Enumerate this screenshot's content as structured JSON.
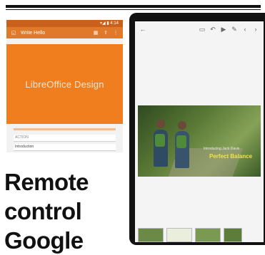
{
  "left_phone": {
    "status_text": "▾◢ ▮ 4:14",
    "appbar_title": "Write Hello",
    "banner_text": "LibreOffice Design",
    "field_label": "ACTION",
    "field_value": "Introduction",
    "icons": [
      "libreoffice-icon",
      "grid-icon",
      "share-icon",
      "more-icon"
    ]
  },
  "heading": {
    "line1": "Remote",
    "line2": "control",
    "line3": "Google"
  },
  "tablet": {
    "toolbar_icons": [
      "back-icon",
      "window-icon",
      "undo-icon",
      "play-icon",
      "pointer-icon",
      "prev-icon",
      "next-icon"
    ],
    "slide_subtitle": "Introducing Jack Davis",
    "slide_title": "Perfect Balance"
  }
}
